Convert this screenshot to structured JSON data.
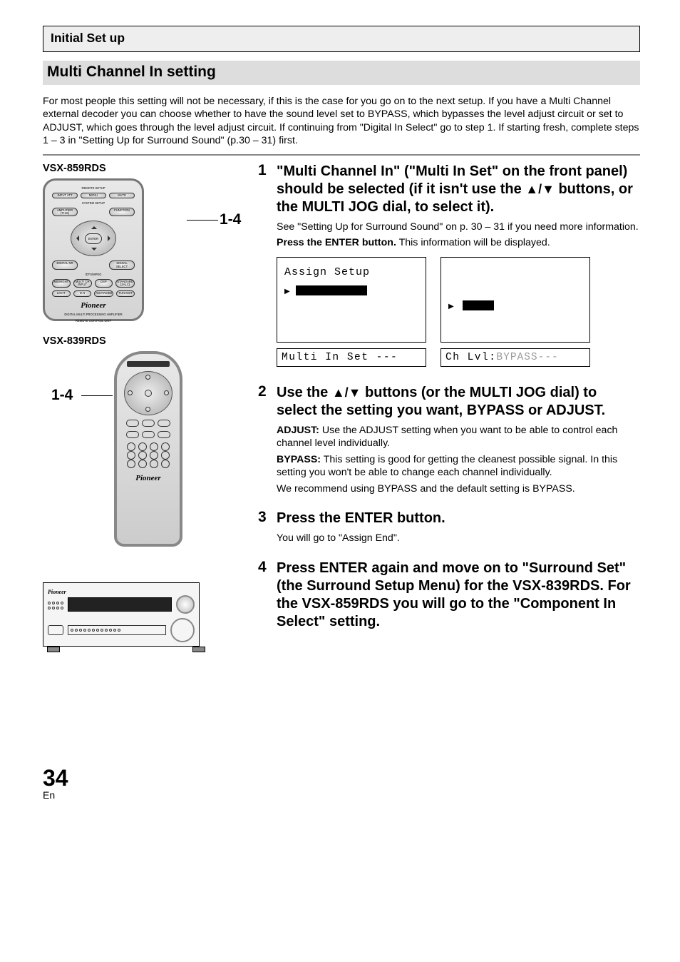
{
  "header": {
    "breadcrumb": "Initial Set up"
  },
  "section": {
    "title": "Multi Channel In setting"
  },
  "intro": "For most people this setting will not be necessary, if this is the case for you go on to the next setup. If you have a Multi Channel external decoder you can choose whether to have the sound level set to BYPASS, which bypasses the level adjust circuit or set to ADJUST, which goes through the level adjust circuit. If continuing from \"Digital In Select\" go to step 1. If starting fresh, complete steps 1 – 3 in \"Setting Up for Surround Sound\" (p.30 – 31) first.",
  "models": {
    "m859": "VSX-859RDS",
    "m839": "VSX-839RDS"
  },
  "callouts": {
    "right": "1-4",
    "left": "1-4"
  },
  "remote859": {
    "r1_label": "REMOTE SETUP",
    "r1a": "INPUT ATT",
    "r1b": "MENU",
    "r1c": "MUTE",
    "r2_label": "SYSTEM SETUP",
    "r2a": "AMPLIFIER (THIS)",
    "r2c": "FUNCTION",
    "enter": "ENTER",
    "r4a": "DIGITAL NR",
    "r4c": "SIGNAL SELECT",
    "dd_line": "/DTS/MPEG",
    "r5a": "MIDNIGHT",
    "r5b": "MULTI CH INPUT",
    "r5c": "DSP",
    "r5d": "STANDARD (2ALC)",
    "r6a": "LIGHT",
    "r6b": "D.N",
    "r6c": "ADVANCED",
    "r6d": "TUN.EDIT",
    "brand": "Pioneer",
    "brand_sub1": "DIGITAL MULTI PROCESSING AMPLIFIER",
    "brand_sub2": "REMOTE CONTROL UNIT"
  },
  "remote839": {
    "brand": "Pioneer"
  },
  "steps": {
    "s1": {
      "num": "1",
      "head_a": "\"Multi Channel In\" (\"Multi In Set\" on the front panel) should be selected (if it isn't use the ",
      "head_b": " buttons, or the MULTI JOG dial, to select it).",
      "p1": "See \"Setting Up for Surround Sound\" on p. 30 – 31 if you need more information.",
      "p2a": "Press the ENTER button.",
      "p2b": " This information will be displayed."
    },
    "s2": {
      "num": "2",
      "head_a": "Use the ",
      "head_b": " buttons (or the MULTI JOG dial)  to select the setting you want, BYPASS or ADJUST.",
      "adj_label": "ADJUST:",
      "adj_text": " Use the ADJUST setting when you want to be able to control each channel level individually.",
      "byp_label": "BYPASS:",
      "byp_text": " This setting is good for getting the cleanest possible signal. In this setting you won't be able to change each channel individually.",
      "rec": "We recommend using BYPASS and the default setting is BYPASS."
    },
    "s3": {
      "num": "3",
      "head": "Press the ENTER button.",
      "p1": "You will go to \"Assign End\"."
    },
    "s4": {
      "num": "4",
      "head": "Press ENTER again and move on to \"Surround Set\" (the Surround Setup Menu) for the VSX-839RDS. For the VSX-859RDS you will go to the \"Component In Select\" setting."
    }
  },
  "symbols": {
    "updown": "▲/▼"
  },
  "lcd": {
    "box1_label": "Assign Setup",
    "fp1": "Multi In Set ---",
    "fp2a": "Ch Lvl:",
    "fp2b": "BYPASS",
    "fp2c": "---"
  },
  "footer": {
    "page": "34",
    "lang": "En"
  }
}
